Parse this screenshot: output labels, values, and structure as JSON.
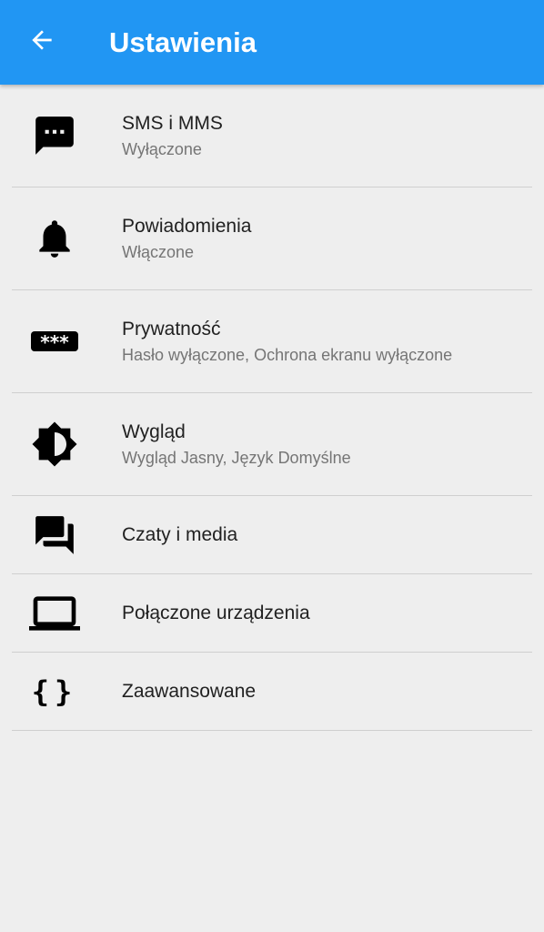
{
  "toolbar": {
    "title": "Ustawienia",
    "back_icon": "arrow-back-icon",
    "background_color": "#2196f3"
  },
  "items": [
    {
      "icon": "sms-icon",
      "title": "SMS i MMS",
      "subtitle": "Wyłączone"
    },
    {
      "icon": "bell-icon",
      "title": "Powiadomienia",
      "subtitle": "Włączone"
    },
    {
      "icon": "password-icon",
      "title": "Prywatność",
      "subtitle": "Hasło wyłączone, Ochrona ekranu wyłączone"
    },
    {
      "icon": "brightness-icon",
      "title": "Wygląd",
      "subtitle": "Wygląd Jasny, Język Domyślne"
    },
    {
      "icon": "forum-icon",
      "title": "Czaty i media"
    },
    {
      "icon": "laptop-icon",
      "title": "Połączone urządzenia"
    },
    {
      "icon": "code-braces-icon",
      "title": "Zaawansowane"
    }
  ]
}
